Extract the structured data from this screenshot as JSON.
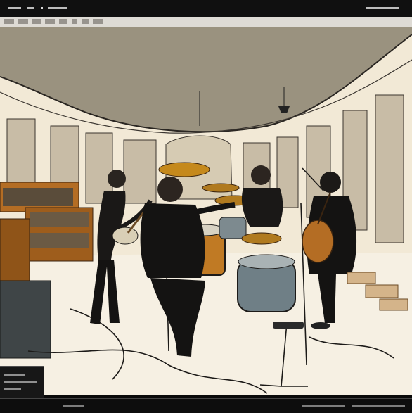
{
  "window": {
    "title": ""
  },
  "toolbar": {
    "items": [
      {
        "icon": "file-icon"
      },
      {
        "icon": "edit-icon"
      },
      {
        "icon": "view-icon"
      },
      {
        "icon": "image-icon"
      },
      {
        "icon": "layer-icon"
      },
      {
        "icon": "select-icon"
      },
      {
        "icon": "filter-icon"
      },
      {
        "icon": "window-icon"
      }
    ]
  },
  "canvas": {
    "artwork": "illustration-band-in-studio",
    "colors": {
      "wall": "#f2e9d6",
      "ceiling": "#9a927f",
      "ink": "#1c1a18",
      "wood": "#b46d24",
      "drum-blue": "#6f7f86"
    }
  },
  "statusbar": {
    "text": ""
  }
}
